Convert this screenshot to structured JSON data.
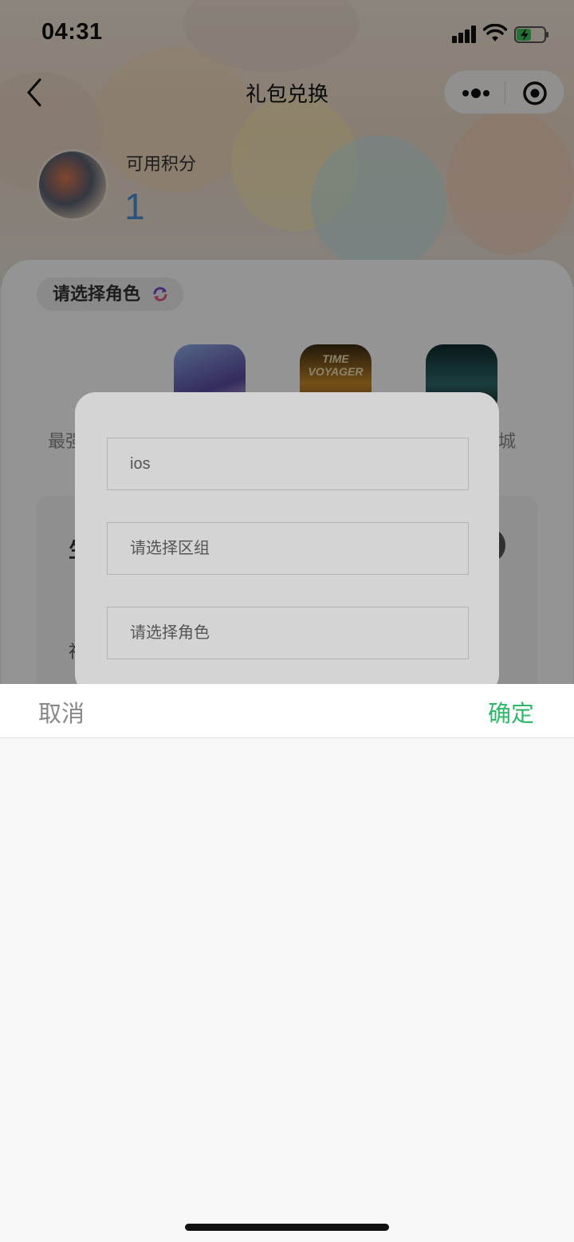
{
  "status_bar": {
    "time": "04:31"
  },
  "nav": {
    "title": "礼包兑换"
  },
  "profile": {
    "points_label": "可用积分",
    "points_value": "1"
  },
  "role_selector": {
    "label": "请选择角色"
  },
  "games": [
    {
      "icon": "game-icon-anime-girl",
      "caption": ""
    },
    {
      "icon": "game-icon-time-voyager",
      "caption": "TIME VOYAGER"
    },
    {
      "icon": "game-icon-cave",
      "caption": ""
    }
  ],
  "behind_text": {
    "left": "最强",
    "right": "城",
    "card_left_top": "生",
    "card_left_bottom": "神"
  },
  "dialog": {
    "platform_value": "ios",
    "server_placeholder": "请选择区组",
    "role_placeholder": "请选择角色"
  },
  "picker": {
    "cancel_label": "取消",
    "confirm_label": "确定"
  },
  "colors": {
    "confirm": "#2fb86a",
    "points": "#4a8fd9"
  }
}
